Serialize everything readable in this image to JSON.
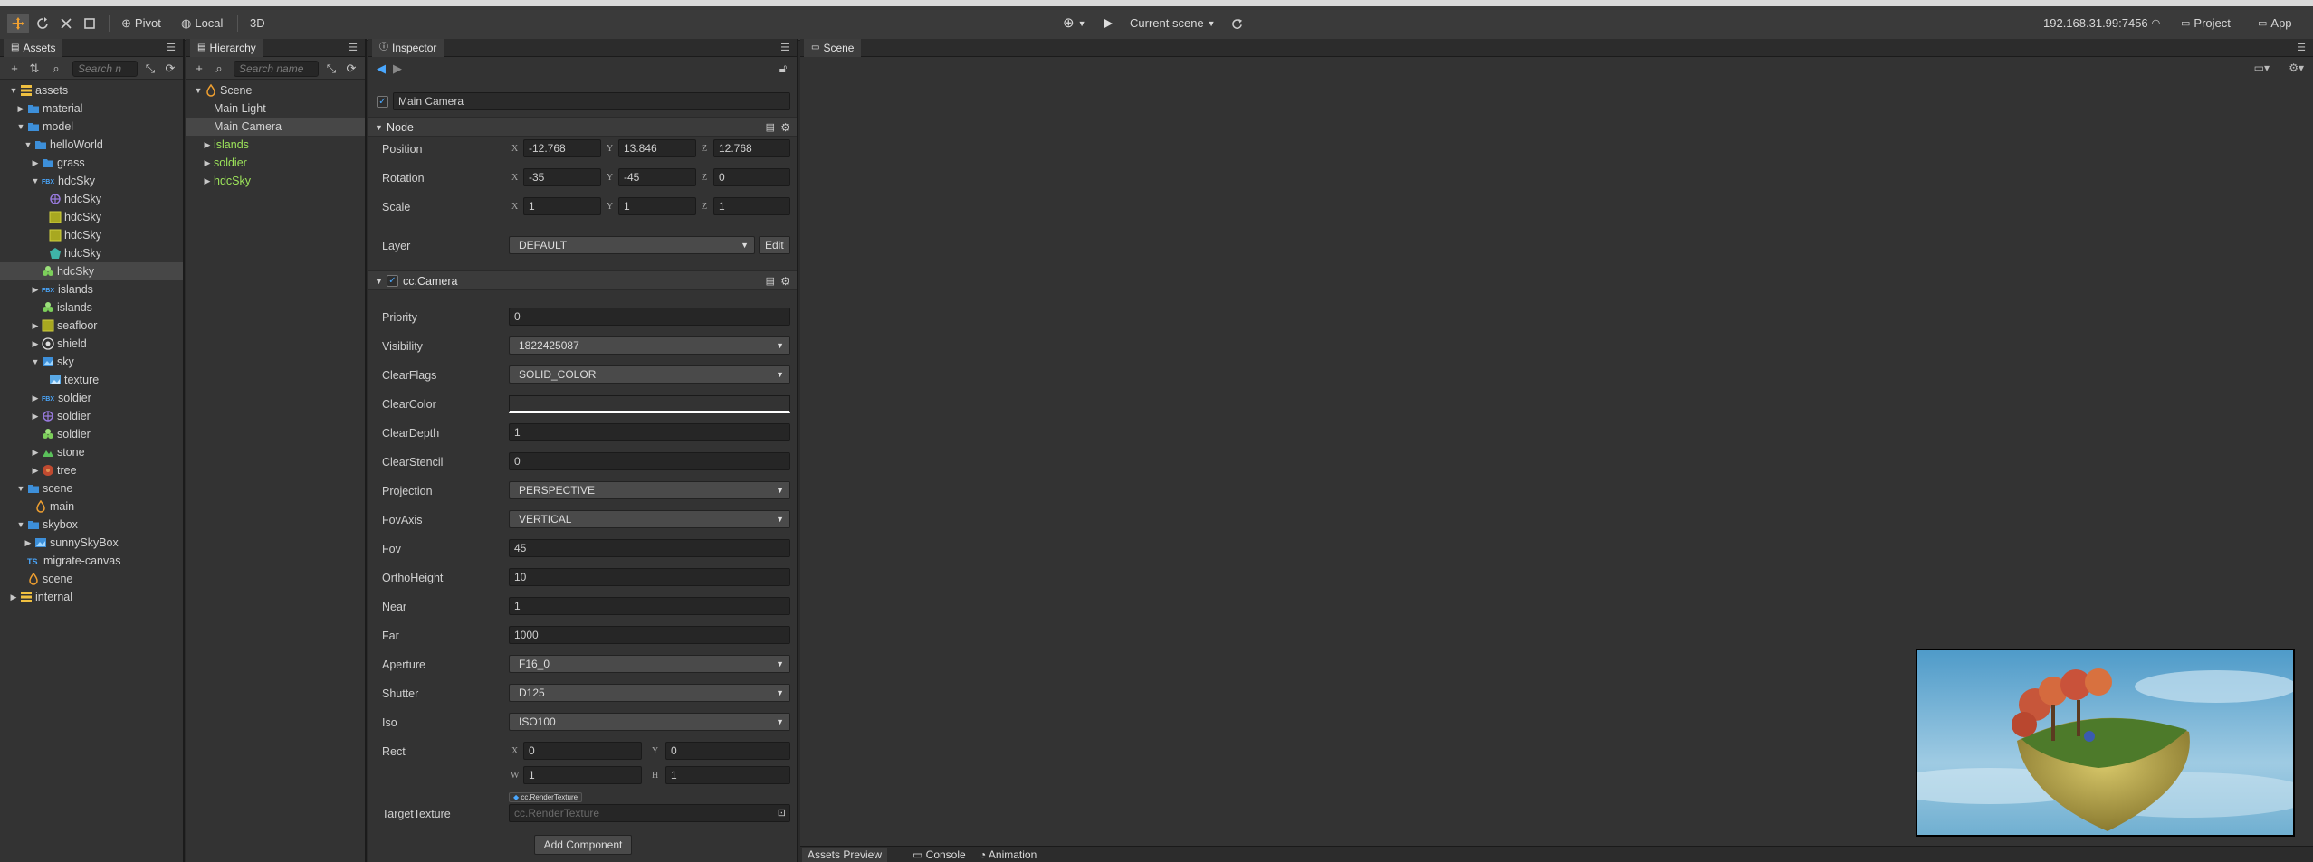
{
  "toolbar": {
    "pivot_label": "Pivot",
    "local_label": "Local",
    "mode_3d_label": "3D",
    "current_scene_label": "Current scene",
    "ip_address": "192.168.31.99:7456",
    "project_label": "Project",
    "app_label": "App"
  },
  "assets_panel": {
    "tab_label": "Assets",
    "search_placeholder": "Search n",
    "tree": [
      {
        "label": "assets",
        "depth": 0,
        "arrow": "down",
        "icon": "db-icon"
      },
      {
        "label": "material",
        "depth": 1,
        "arrow": "right",
        "icon": "folder-icon"
      },
      {
        "label": "model",
        "depth": 1,
        "arrow": "down",
        "icon": "folder-icon"
      },
      {
        "label": "helloWorld",
        "depth": 2,
        "arrow": "down",
        "icon": "folder-icon"
      },
      {
        "label": "grass",
        "depth": 3,
        "arrow": "right",
        "icon": "folder-icon"
      },
      {
        "label": "hdcSky",
        "depth": 3,
        "arrow": "down",
        "icon": "fbx-icon"
      },
      {
        "label": "hdcSky",
        "depth": 4,
        "arrow": "",
        "icon": "skeleton-icon"
      },
      {
        "label": "hdcSky",
        "depth": 4,
        "arrow": "",
        "icon": "material-icon"
      },
      {
        "label": "hdcSky",
        "depth": 4,
        "arrow": "",
        "icon": "material-icon"
      },
      {
        "label": "hdcSky",
        "depth": 4,
        "arrow": "",
        "icon": "mesh-icon"
      },
      {
        "label": "hdcSky",
        "depth": 3,
        "arrow": "",
        "icon": "prefab-icon",
        "selected": true
      },
      {
        "label": "islands",
        "depth": 3,
        "arrow": "right",
        "icon": "fbx-icon"
      },
      {
        "label": "islands",
        "depth": 3,
        "arrow": "",
        "icon": "prefab-icon"
      },
      {
        "label": "seafloor",
        "depth": 3,
        "arrow": "right",
        "icon": "material-icon"
      },
      {
        "label": "shield",
        "depth": 3,
        "arrow": "right",
        "icon": "effect-icon"
      },
      {
        "label": "sky",
        "depth": 3,
        "arrow": "down",
        "icon": "image-icon"
      },
      {
        "label": "texture",
        "depth": 4,
        "arrow": "",
        "icon": "texture-icon"
      },
      {
        "label": "soldier",
        "depth": 3,
        "arrow": "right",
        "icon": "fbx-icon"
      },
      {
        "label": "soldier",
        "depth": 3,
        "arrow": "right",
        "icon": "skeleton-icon"
      },
      {
        "label": "soldier",
        "depth": 3,
        "arrow": "",
        "icon": "prefab-icon"
      },
      {
        "label": "stone",
        "depth": 3,
        "arrow": "right",
        "icon": "terrain-icon"
      },
      {
        "label": "tree",
        "depth": 3,
        "arrow": "right",
        "icon": "tree-icon"
      },
      {
        "label": "scene",
        "depth": 1,
        "arrow": "down",
        "icon": "folder-icon"
      },
      {
        "label": "main",
        "depth": 2,
        "arrow": "",
        "icon": "scene-icon"
      },
      {
        "label": "skybox",
        "depth": 1,
        "arrow": "down",
        "icon": "folder-icon"
      },
      {
        "label": "sunnySkyBox",
        "depth": 2,
        "arrow": "right",
        "icon": "image-icon"
      },
      {
        "label": "migrate-canvas",
        "depth": 1,
        "arrow": "",
        "icon": "ts-icon"
      },
      {
        "label": "scene",
        "depth": 1,
        "arrow": "",
        "icon": "scene-icon"
      },
      {
        "label": "internal",
        "depth": 0,
        "arrow": "right",
        "icon": "db-icon"
      }
    ]
  },
  "hierarchy_panel": {
    "tab_label": "Hierarchy",
    "search_placeholder": "Search name",
    "tree": [
      {
        "label": "Scene",
        "depth": 0,
        "arrow": "down",
        "icon": "scene-icon",
        "green": false
      },
      {
        "label": "Main Light",
        "depth": 1,
        "arrow": "",
        "green": false
      },
      {
        "label": "Main Camera",
        "depth": 1,
        "arrow": "",
        "green": false,
        "selected": true
      },
      {
        "label": "islands",
        "depth": 1,
        "arrow": "right",
        "green": true
      },
      {
        "label": "soldier",
        "depth": 1,
        "arrow": "right",
        "green": true
      },
      {
        "label": "hdcSky",
        "depth": 1,
        "arrow": "right",
        "green": true
      }
    ]
  },
  "inspector": {
    "tab_label": "Inspector",
    "node_name": "Main Camera",
    "node_section": "Node",
    "position": {
      "label": "Position",
      "x": "-12.768",
      "y": "13.846",
      "z": "12.768"
    },
    "rotation": {
      "label": "Rotation",
      "x": "-35",
      "y": "-45",
      "z": "0"
    },
    "scale": {
      "label": "Scale",
      "x": "1",
      "y": "1",
      "z": "1"
    },
    "layer": {
      "label": "Layer",
      "value": "DEFAULT",
      "edit_label": "Edit"
    },
    "camera_section": "cc.Camera",
    "axes": {
      "x": "X",
      "y": "Y",
      "z": "Z",
      "w": "W",
      "h": "H"
    },
    "props": {
      "priority": {
        "label": "Priority",
        "value": "0"
      },
      "visibility": {
        "label": "Visibility",
        "value": "1822425087"
      },
      "clear_flags": {
        "label": "ClearFlags",
        "value": "SOLID_COLOR"
      },
      "clear_color": {
        "label": "ClearColor",
        "value": "#333333"
      },
      "clear_depth": {
        "label": "ClearDepth",
        "value": "1"
      },
      "clear_stencil": {
        "label": "ClearStencil",
        "value": "0"
      },
      "projection": {
        "label": "Projection",
        "value": "PERSPECTIVE"
      },
      "fov_axis": {
        "label": "FovAxis",
        "value": "VERTICAL"
      },
      "fov": {
        "label": "Fov",
        "value": "45"
      },
      "ortho_height": {
        "label": "OrthoHeight",
        "value": "10"
      },
      "near": {
        "label": "Near",
        "value": "1"
      },
      "far": {
        "label": "Far",
        "value": "1000"
      },
      "aperture": {
        "label": "Aperture",
        "value": "F16_0"
      },
      "shutter": {
        "label": "Shutter",
        "value": "D125"
      },
      "iso": {
        "label": "Iso",
        "value": "ISO100"
      },
      "rect": {
        "label": "Rect",
        "x": "0",
        "y": "0",
        "w": "1",
        "h": "1"
      },
      "target_texture": {
        "label": "TargetTexture",
        "badge": "cc.RenderTexture",
        "placeholder": "cc.RenderTexture"
      }
    },
    "add_component_label": "Add Component"
  },
  "scene_panel": {
    "tab_label": "Scene"
  },
  "bottom_tabs": [
    "Assets Preview",
    "Console",
    "Animation"
  ],
  "colors": {
    "accent": "#4aa8ff",
    "green_node": "#9ce35a",
    "panel_bg": "#333333"
  }
}
